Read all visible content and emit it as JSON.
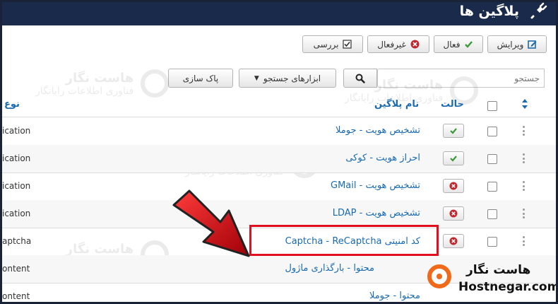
{
  "header": {
    "title": "پلاگین ها",
    "icon": "plug-icon"
  },
  "toolbar": {
    "edit_label": "ویرایش",
    "enable_label": "فعال",
    "disable_label": "غیرفعال",
    "check_label": "بررسی"
  },
  "search": {
    "placeholder": "جستجو",
    "tools_label": "ابزارهای جستجو",
    "clear_label": "پاک سازی"
  },
  "columns": {
    "status": "حالت",
    "name": "نام پلاگین",
    "type": "نوع"
  },
  "rows": [
    {
      "name": "تشخیص هویت - جوملا",
      "type": "ication",
      "enabled": true
    },
    {
      "name": "احراز هویت - کوکی",
      "type": "ication",
      "enabled": true
    },
    {
      "name": "تشخیص هویت - GMail",
      "type": "ication",
      "enabled": false
    },
    {
      "name": "تشخیص هویت - LDAP",
      "type": "ication",
      "enabled": false
    },
    {
      "name": "کد امنیتی Captcha - ReCaptcha",
      "type": "aptcha",
      "enabled": false
    },
    {
      "name": "محتوا - بارگذاری ماژول",
      "type": "ontent",
      "enabled": null
    },
    {
      "name": "محتوا - جوملا",
      "type": "ontent",
      "enabled": null
    }
  ],
  "watermark": {
    "brand": "هاست نگار",
    "tagline": "فناوری اطلاعات رایانگار"
  },
  "logo": {
    "fa": "هاست نگار",
    "en": "Hostnegar.com"
  },
  "colors": {
    "header_bg": "#1a2a4a",
    "link": "#1a6ab0",
    "enabled_check": "#3a9a3a",
    "disabled_x": "#c0282f",
    "highlight": "#e0101e",
    "arrow": "#d8101a",
    "logo_orange": "#f06a1a"
  }
}
